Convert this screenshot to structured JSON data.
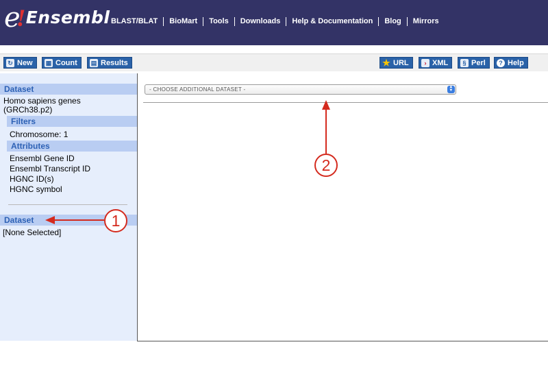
{
  "header": {
    "logo": {
      "e": "e",
      "bang": "!",
      "text": "Ensembl"
    },
    "nav": [
      "BLAST/BLAT",
      "BioMart",
      "Tools",
      "Downloads",
      "Help & Documentation",
      "Blog",
      "Mirrors"
    ]
  },
  "toolbar": {
    "new_label": "New",
    "count_label": "Count",
    "results_label": "Results",
    "url_label": "URL",
    "xml_label": "XML",
    "perl_label": "Perl",
    "help_label": "Help"
  },
  "sidebar": {
    "dataset1_header": "Dataset",
    "dataset1_line1": "Homo sapiens genes",
    "dataset1_line2": "(GRCh38.p2)",
    "filters_header": "Filters",
    "filter_chromosome": "Chromosome: 1",
    "attributes_header": "Attributes",
    "attributes": [
      "Ensembl Gene ID",
      "Ensembl Transcript ID",
      "HGNC ID(s)",
      "HGNC symbol"
    ],
    "dataset2_header": "Dataset",
    "dataset2_value": "[None Selected]"
  },
  "main": {
    "dataset_select": "- CHOOSE ADDITIONAL DATASET -"
  },
  "annotations": {
    "marker1": "1",
    "marker2": "2"
  },
  "colors": {
    "header_bg": "#333366",
    "button_blue": "#2a62a8",
    "sidebar_bg": "#e6eefc",
    "section_header_bg": "#b9cdf2",
    "section_header_text": "#2d61b5",
    "annotation_red": "#d42a1e"
  }
}
